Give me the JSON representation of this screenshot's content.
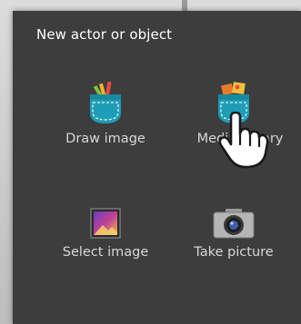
{
  "dialog": {
    "title": "New actor or object",
    "options": [
      {
        "label": "Draw image",
        "icon": "pocket-pencils-icon"
      },
      {
        "label": "Media library",
        "icon": "pocket-media-icon"
      },
      {
        "label": "Select image",
        "icon": "gallery-picture-icon"
      },
      {
        "label": "Take picture",
        "icon": "camera-icon"
      }
    ]
  },
  "colors": {
    "dialog_background": "#3d3d3d",
    "title_text": "#ffffff",
    "option_text": "#d8d8d8",
    "pocket_teal": "#1e9db7"
  },
  "overlay": {
    "icon": "pointing-hand-icon"
  }
}
